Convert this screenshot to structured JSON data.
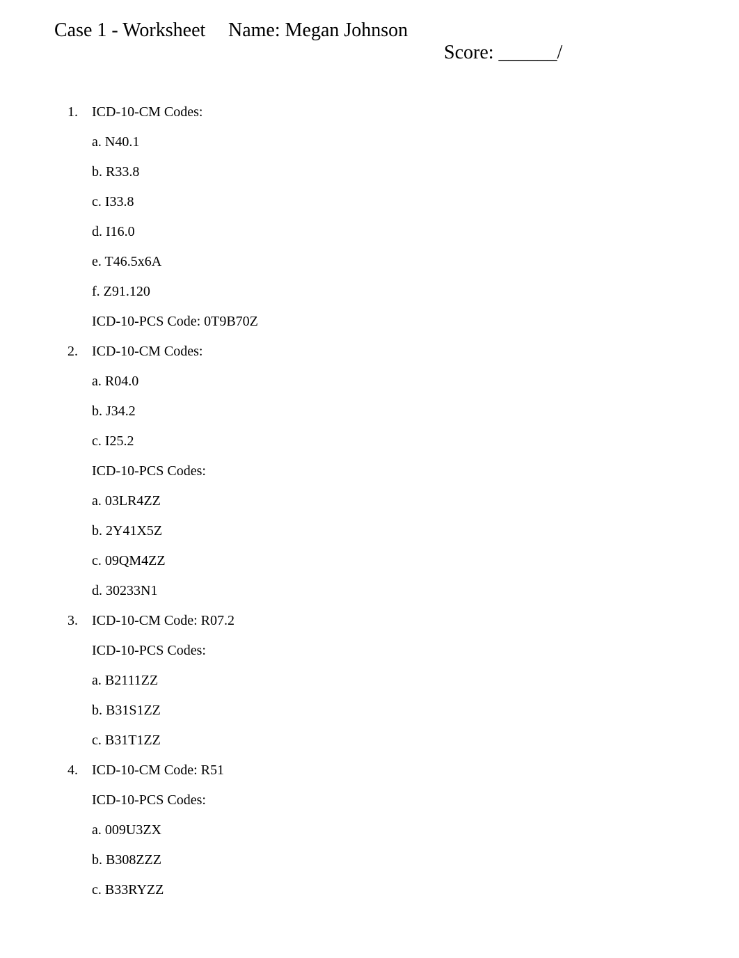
{
  "header": {
    "title": "Case 1 - Worksheet",
    "name_label": "Name: ",
    "name_value": "Megan Johnson",
    "score_label": "Score: ",
    "score_blank": "______",
    "score_suffix": "/"
  },
  "questions": [
    {
      "number": "1.",
      "label": "ICD-10-CM Codes:",
      "subs": [
        "a. N40.1",
        "b. R33.8",
        "c. I33.8",
        "d. I16.0",
        "e. T46.5x6A",
        "f. Z91.120",
        "ICD-10-PCS Code: 0T9B70Z"
      ]
    },
    {
      "number": "2.",
      "label": "ICD-10-CM Codes:",
      "subs": [
        "a. R04.0",
        "b. J34.2",
        "c. I25.2",
        "ICD-10-PCS Codes:",
        "a. 03LR4ZZ",
        "b. 2Y41X5Z",
        "c. 09QM4ZZ",
        "d. 30233N1"
      ]
    },
    {
      "number": "3.",
      "label": "ICD-10-CM Code: R07.2",
      "subs": [
        "ICD-10-PCS Codes:",
        "a. B2111ZZ",
        "b. B31S1ZZ",
        "c. B31T1ZZ"
      ]
    },
    {
      "number": "4.",
      "label": "ICD-10-CM Code: R51",
      "subs": [
        "ICD-10-PCS Codes:",
        "a. 009U3ZX",
        "b. B308ZZZ",
        "c. B33RYZZ"
      ]
    }
  ]
}
